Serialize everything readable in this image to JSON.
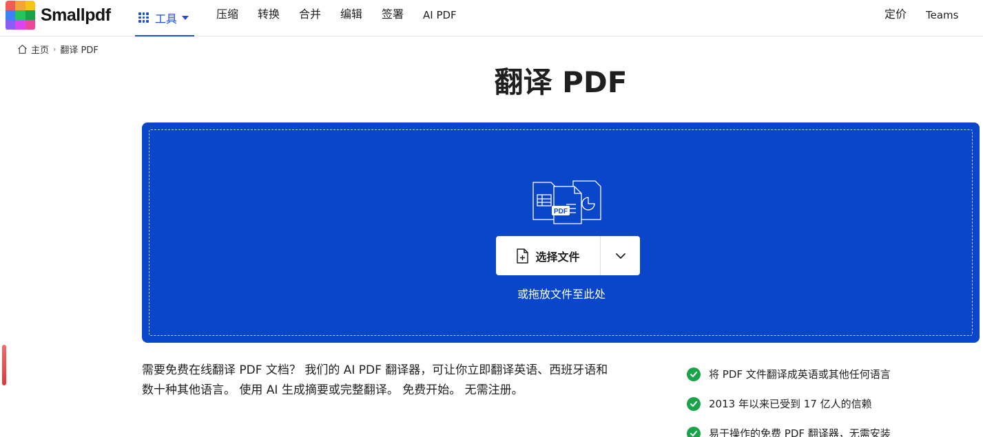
{
  "brand": {
    "name": "Smallpdf"
  },
  "nav": {
    "tools_label": "工具",
    "items": [
      "压缩",
      "转换",
      "合并",
      "编辑",
      "签署",
      "AI PDF"
    ],
    "pricing": "定价",
    "teams": "Teams"
  },
  "breadcrumb": {
    "home": "主页",
    "current": "翻译 PDF"
  },
  "page": {
    "title": "翻译 PDF"
  },
  "upload": {
    "choose_label": "选择文件",
    "drop_hint": "或拖放文件至此处",
    "illus_badge": "PDF"
  },
  "description": "需要免费在线翻译 PDF 文档？ 我们的 AI PDF 翻译器，可让你立即翻译英语、西班牙语和数十种其他语言。 使用 AI 生成摘要或完整翻译。 免费开始。 无需注册。",
  "features": [
    "将 PDF 文件翻译成英语或其他任何语言",
    "2013 年以来已受到 17 亿人的信赖",
    "易于操作的免费 PDF 翻译器，无需安装"
  ],
  "colors": {
    "accent": "#1d4ed8",
    "dropzone": "#0a46c9",
    "check": "#1aa34a"
  }
}
